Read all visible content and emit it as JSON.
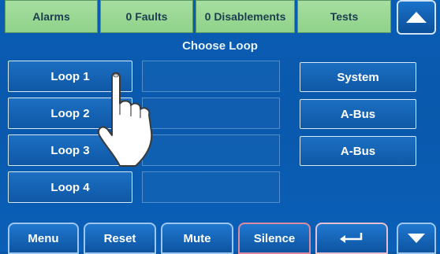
{
  "status_bar": {
    "tabs": [
      {
        "label": "Alarms"
      },
      {
        "label": "0 Faults"
      },
      {
        "label": "0 Disablements"
      },
      {
        "label": "Tests"
      }
    ],
    "scroll_up_icon": "triangle-up-icon"
  },
  "heading": "Choose Loop",
  "loops": [
    {
      "label": "Loop 1"
    },
    {
      "label": "Loop 2"
    },
    {
      "label": "Loop 3"
    },
    {
      "label": "Loop 4"
    }
  ],
  "right_buttons": [
    {
      "label": "System"
    },
    {
      "label": "A-Bus"
    },
    {
      "label": "A-Bus"
    }
  ],
  "bottom_bar": {
    "menu": "Menu",
    "reset": "Reset",
    "mute": "Mute",
    "silence": "Silence",
    "enter_icon": "enter-return-icon",
    "scroll_down_icon": "triangle-down-icon"
  },
  "colors": {
    "background": "#0a5db4",
    "status_tab": "#9dd897",
    "button": "#1565b8"
  }
}
